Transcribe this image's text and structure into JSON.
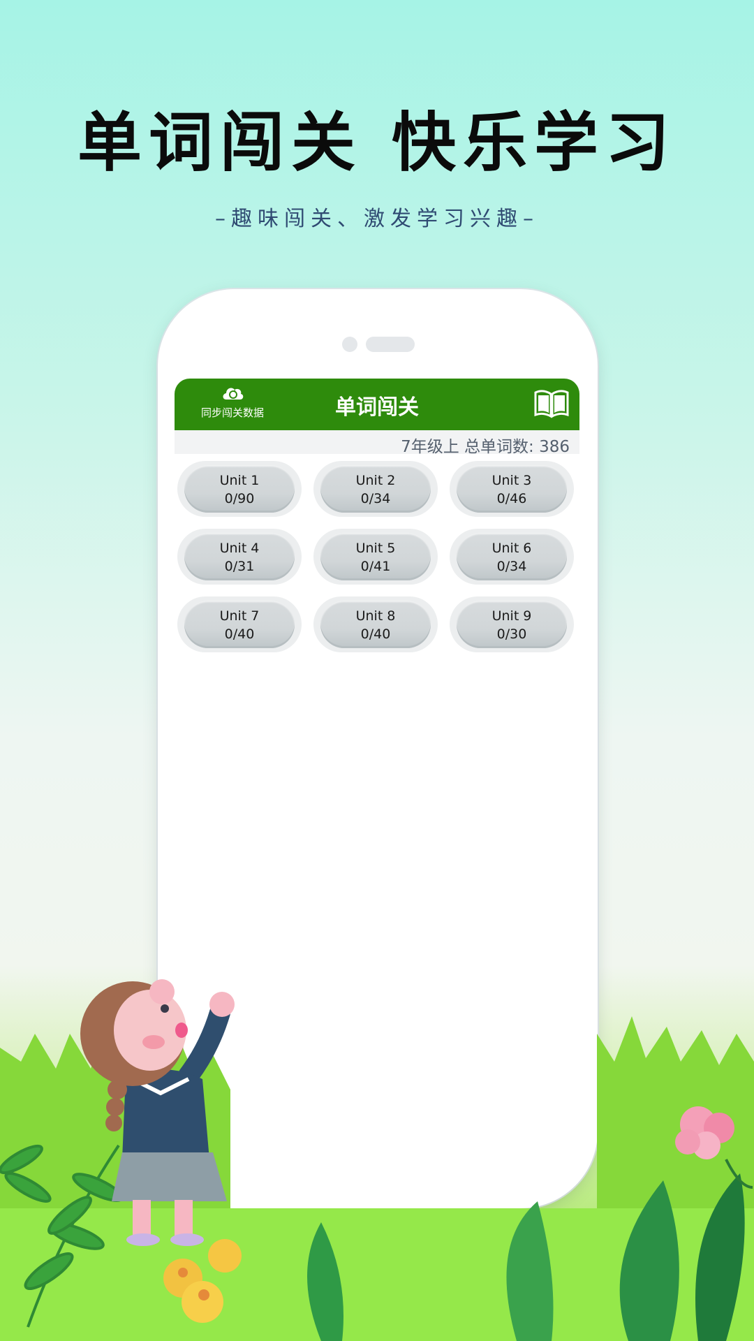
{
  "hero": {
    "title": "单词闯关 快乐学习",
    "subtitle": "–趣味闯关、激发学习兴趣–"
  },
  "app": {
    "sync_label": "同步闯关数据",
    "title": "单词闯关",
    "summary": "7年级上 总单词数: 386",
    "units": [
      {
        "name": "Unit 1",
        "progress": "0/90"
      },
      {
        "name": "Unit 2",
        "progress": "0/34"
      },
      {
        "name": "Unit 3",
        "progress": "0/46"
      },
      {
        "name": "Unit 4",
        "progress": "0/31"
      },
      {
        "name": "Unit 5",
        "progress": "0/41"
      },
      {
        "name": "Unit 6",
        "progress": "0/34"
      },
      {
        "name": "Unit 7",
        "progress": "0/40"
      },
      {
        "name": "Unit 8",
        "progress": "0/40"
      },
      {
        "name": "Unit 9",
        "progress": "0/30"
      }
    ],
    "icons": {
      "sync": "cloud-sync-icon",
      "book": "book-icon"
    },
    "colors": {
      "appbar": "#2e8b0c",
      "unit_button": "#d4d9db"
    }
  }
}
